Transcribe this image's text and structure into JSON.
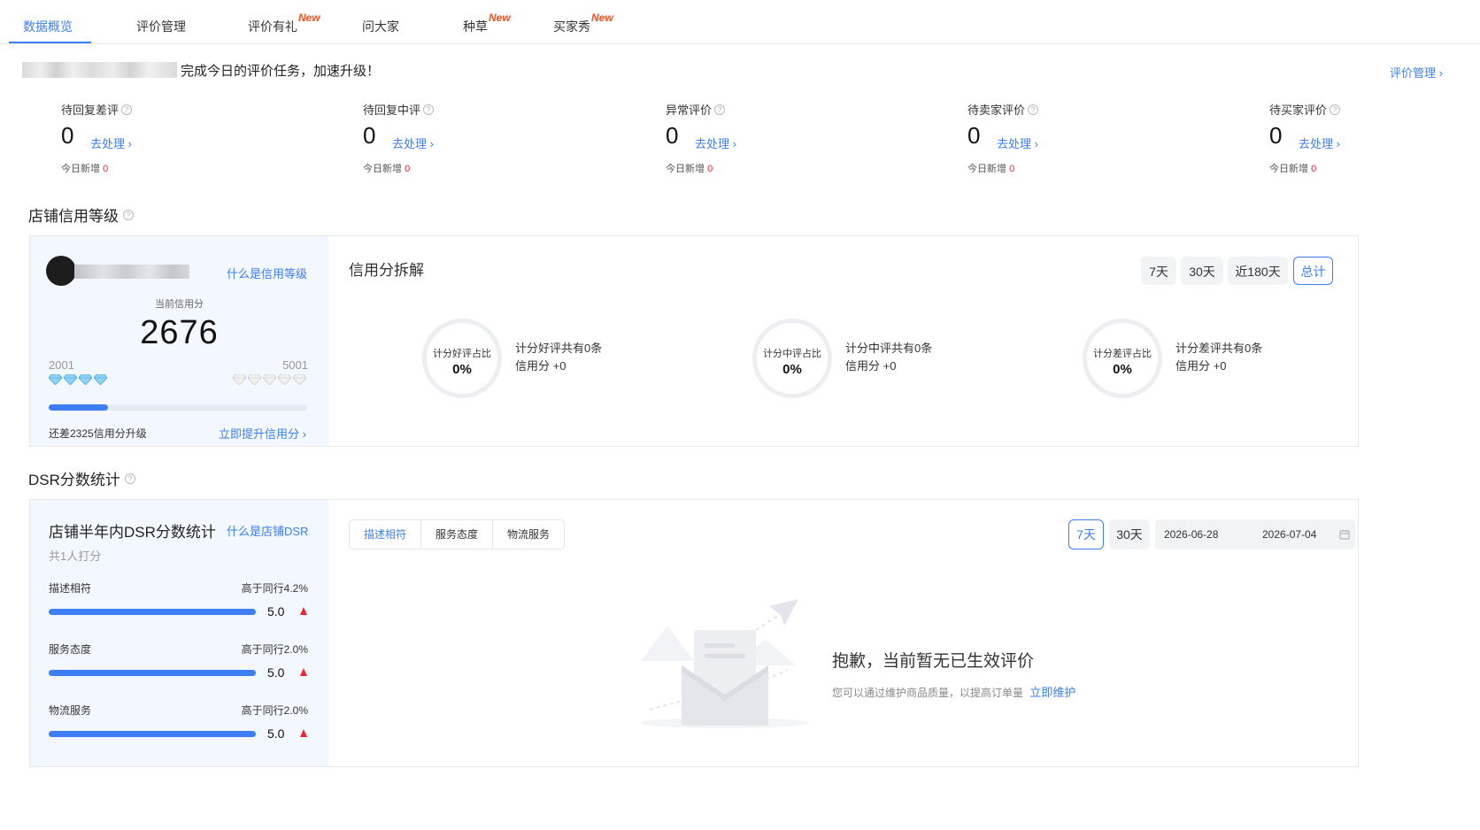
{
  "tabs": [
    {
      "label": "数据概览",
      "badge": "",
      "active": true
    },
    {
      "label": "评价管理",
      "badge": ""
    },
    {
      "label": "评价有礼",
      "badge": "New"
    },
    {
      "label": "问大家",
      "badge": ""
    },
    {
      "label": "种草",
      "badge": "New"
    },
    {
      "label": "买家秀",
      "badge": "New"
    }
  ],
  "greeting": {
    "text": "完成今日的评价任务，加速升级！",
    "link": "评价管理 ›"
  },
  "stats": [
    {
      "title": "待回复差评",
      "value": "0",
      "action": "去处理 ›",
      "sub_label": "今日新增",
      "sub_value": "0"
    },
    {
      "title": "待回复中评",
      "value": "0",
      "action": "去处理 ›",
      "sub_label": "今日新增",
      "sub_value": "0"
    },
    {
      "title": "异常评价",
      "value": "0",
      "action": "去处理 ›",
      "sub_label": "今日新增",
      "sub_value": "0"
    },
    {
      "title": "待卖家评价",
      "value": "0",
      "action": "去处理 ›",
      "sub_label": "今日新增",
      "sub_value": "0"
    },
    {
      "title": "待买家评价",
      "value": "0",
      "action": "去处理 ›",
      "sub_label": "今日新增",
      "sub_value": "0"
    }
  ],
  "credit": {
    "section_title": "店铺信用等级",
    "what_link": "什么是信用等级",
    "current_label": "当前信用分",
    "current_value": "2676",
    "range_min": "2001",
    "range_max": "5001",
    "progress_fraction": 0.23,
    "upgrade_text": "还差2325信用分升级",
    "boost_link": "立即提升信用分 ›",
    "breakdown_title": "信用分拆解",
    "periods": [
      "7天",
      "30天",
      "近180天",
      "总计"
    ],
    "active_period": "总计",
    "rings": [
      {
        "label": "计分好评占比",
        "value": "0%",
        "desc1": "计分好评共有0条",
        "desc2": "信用分 +0"
      },
      {
        "label": "计分中评占比",
        "value": "0%",
        "desc1": "计分中评共有0条",
        "desc2": "信用分 +0"
      },
      {
        "label": "计分差评占比",
        "value": "0%",
        "desc1": "计分差评共有0条",
        "desc2": "信用分 +0"
      }
    ]
  },
  "dsr": {
    "section_title": "DSR分数统计",
    "card_title": "店铺半年内DSR分数统计",
    "what_link": "什么是店铺DSR",
    "sub": "共1人打分",
    "items": [
      {
        "label": "描述相符",
        "compare": "高于同行4.2%",
        "score": "5.0"
      },
      {
        "label": "服务态度",
        "compare": "高于同行2.0%",
        "score": "5.0"
      },
      {
        "label": "物流服务",
        "compare": "高于同行2.0%",
        "score": "5.0"
      }
    ],
    "tabs": [
      "描述相符",
      "服务态度",
      "物流服务"
    ],
    "active_tab": "描述相符",
    "periods": [
      "7天",
      "30天"
    ],
    "active_period": "7天",
    "date_start": "2026-06-28",
    "date_end": "2026-07-04",
    "empty_title": "抱歉，当前暂无已生效评价",
    "empty_sub": "您可以通过维护商品质量，以提高订单量",
    "empty_link": "立即维护"
  },
  "colors": {
    "accent": "#3d7ef5",
    "badge": "#ff4d1a",
    "alert": "#f5222d",
    "card_bg": "#f3f7ff"
  },
  "icons": [
    "help-icon",
    "gem-icon",
    "calendar-icon",
    "up-arrow-icon",
    "empty-envelope-illustration"
  ]
}
